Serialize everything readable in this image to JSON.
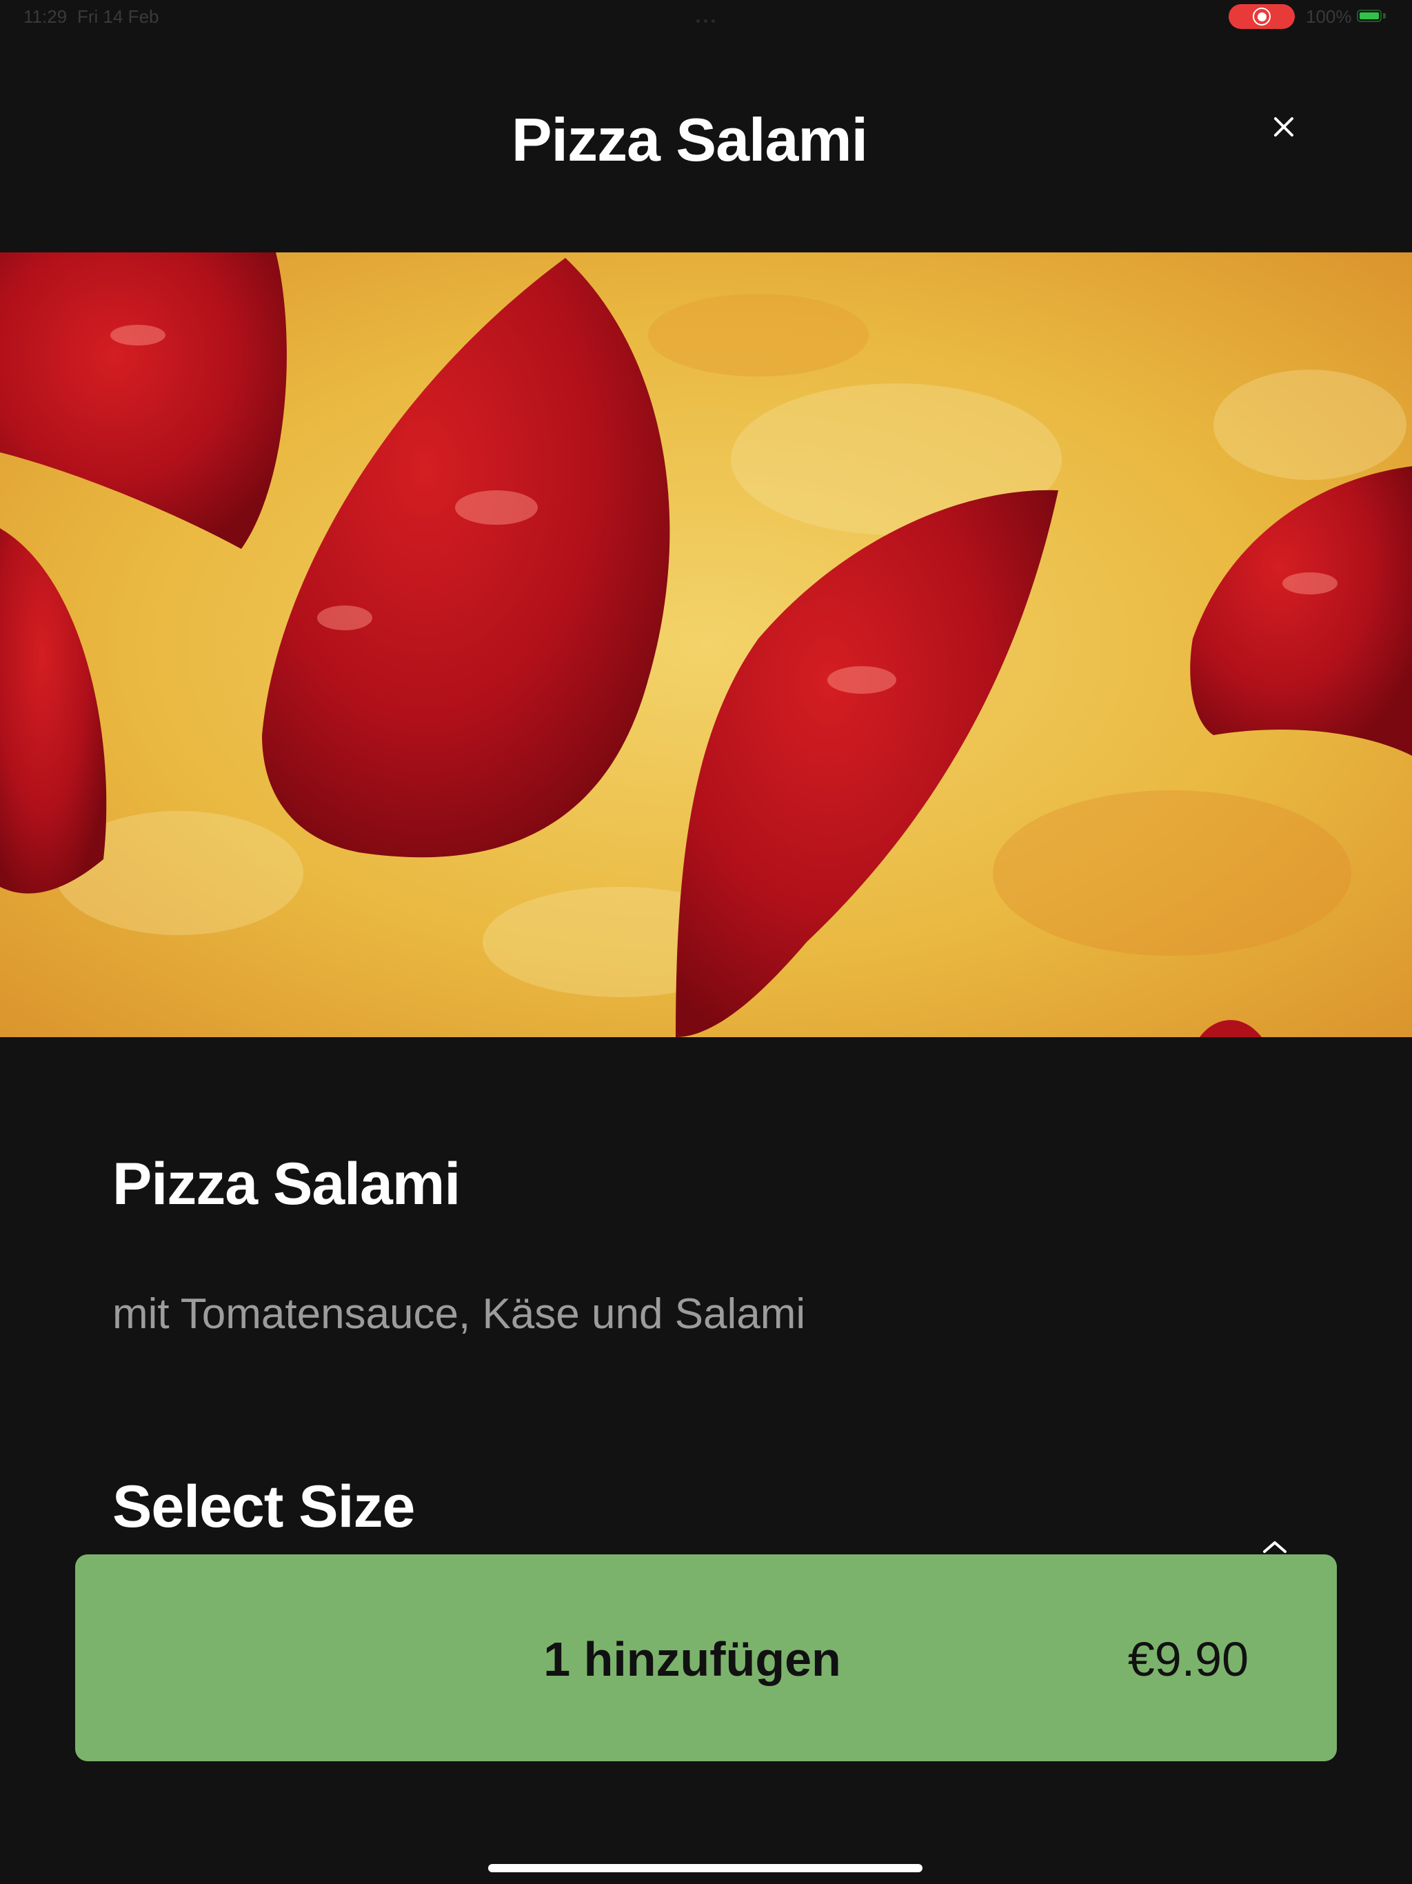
{
  "status_bar": {
    "time": "11:29",
    "date": "Fri 14 Feb",
    "battery_text": "100%",
    "battery_level": 1.0,
    "record_color": "#e93a3a",
    "battery_color": "#32c24a"
  },
  "header": {
    "title": "Pizza Salami",
    "close_icon": "close-icon"
  },
  "hero_image": {
    "description_icon": "pizza-photo"
  },
  "product": {
    "name": "Pizza Salami",
    "description": "mit Tomatensauce, Käse und Salami"
  },
  "size_section": {
    "title": "Select Size",
    "toggle_icon": "chevron-up-icon"
  },
  "add_button": {
    "label": "1 hinzufügen",
    "price": "€9.90",
    "color": "#7cb36c"
  },
  "colors": {
    "background": "#121212",
    "text": "#ffffff",
    "muted_text": "#9c9c9c"
  }
}
